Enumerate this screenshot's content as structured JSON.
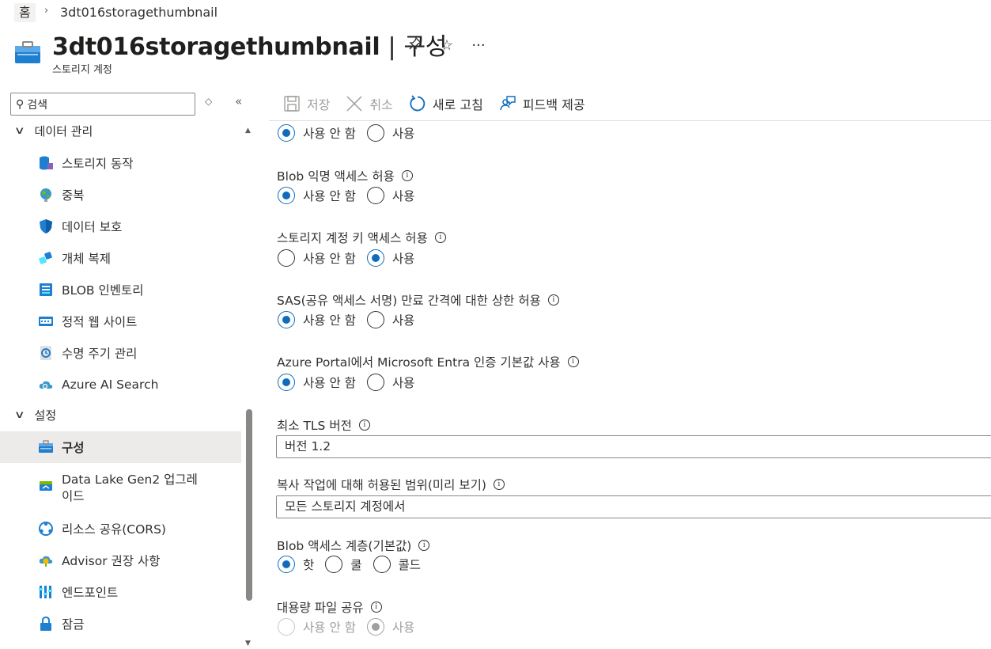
{
  "breadcrumb": {
    "home": "홈",
    "current": "3dt016storagethumbnail"
  },
  "header": {
    "resource": "3dt016storagethumbnail",
    "separator": "|",
    "section": "구성",
    "subtitle": "스토리지 계정"
  },
  "sidebar": {
    "search_placeholder": "검색",
    "groups": [
      {
        "label": "데이터 관리"
      },
      {
        "label": "설정"
      }
    ],
    "items": [
      {
        "label": "스토리지 동작",
        "icon": "storage-action-icon"
      },
      {
        "label": "중복",
        "icon": "globe-icon"
      },
      {
        "label": "데이터 보호",
        "icon": "shield-icon"
      },
      {
        "label": "개체 복제",
        "icon": "object-replication-icon"
      },
      {
        "label": "BLOB 인벤토리",
        "icon": "inventory-icon"
      },
      {
        "label": "정적 웹 사이트",
        "icon": "static-website-icon"
      },
      {
        "label": "수명 주기 관리",
        "icon": "lifecycle-icon"
      },
      {
        "label": "Azure AI Search",
        "icon": "cloud-search-icon"
      },
      {
        "label": "구성",
        "icon": "configuration-icon",
        "selected": true
      },
      {
        "label_line1": "Data Lake Gen2 업그레",
        "label_line2": "이드",
        "icon": "data-lake-icon"
      },
      {
        "label": "리소스 공유(CORS)",
        "icon": "cors-icon"
      },
      {
        "label": "Advisor 권장 사항",
        "icon": "advisor-icon"
      },
      {
        "label": "엔드포인트",
        "icon": "endpoints-icon"
      },
      {
        "label": "잠금",
        "icon": "lock-icon"
      }
    ]
  },
  "toolbar": {
    "save": "저장",
    "cancel": "취소",
    "refresh": "새로 고침",
    "feedback": "피드백 제공"
  },
  "form": {
    "top_radio": {
      "opt1": "사용 안 함",
      "opt2": "사용",
      "selected": "opt1"
    },
    "blob_anon": {
      "label": "Blob 익명 액세스 허용",
      "opt1": "사용 안 함",
      "opt2": "사용",
      "selected": "opt1"
    },
    "key_access": {
      "label": "스토리지 계정 키 액세스 허용",
      "opt1": "사용 안 함",
      "opt2": "사용",
      "selected": "opt2"
    },
    "sas_expiry": {
      "label": "SAS(공유 액세스 서명) 만료 간격에 대한 상한 허용",
      "opt1": "사용 안 함",
      "opt2": "사용",
      "selected": "opt1"
    },
    "entra_default": {
      "label": "Azure Portal에서 Microsoft Entra 인증 기본값 사용",
      "opt1": "사용 안 함",
      "opt2": "사용",
      "selected": "opt1"
    },
    "min_tls": {
      "label": "최소 TLS 버전",
      "value": "버전 1.2"
    },
    "copy_scope": {
      "label": "복사 작업에 대해 허용된 범위(미리 보기)",
      "value": "모든 스토리지 계정에서"
    },
    "access_tier": {
      "label": "Blob 액세스 계층(기본값)",
      "opt1": "핫",
      "opt2": "쿨",
      "opt3": "콜드",
      "selected": "opt1"
    },
    "large_file": {
      "label": "대용량 파일 공유",
      "opt1": "사용 안 함",
      "opt2": "사용",
      "selected": "opt2",
      "disabled": true
    }
  },
  "colors": {
    "accent": "#0f6cbd",
    "selected_bg": "#edebe9"
  }
}
